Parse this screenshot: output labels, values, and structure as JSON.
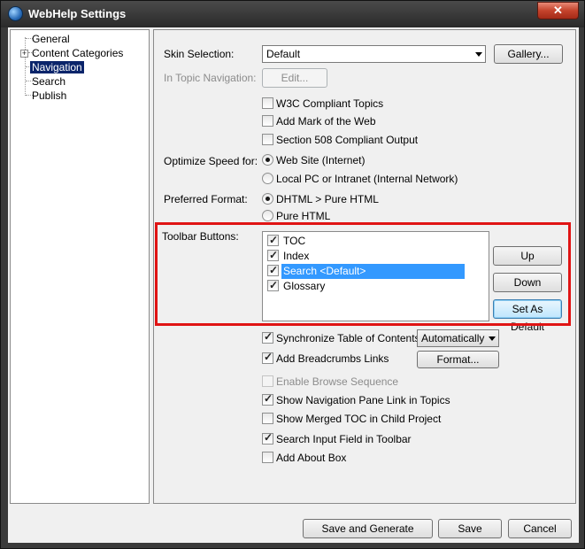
{
  "window": {
    "title": "WebHelp Settings",
    "close_glyph": "✕",
    "icon": "globe-icon"
  },
  "tree": {
    "items": [
      {
        "label": "General"
      },
      {
        "label": "Content Categories",
        "expander": "+"
      },
      {
        "label": "Navigation",
        "selected": true
      },
      {
        "label": "Search"
      },
      {
        "label": "Publish"
      }
    ]
  },
  "skin": {
    "label": "Skin Selection:",
    "value": "Default",
    "gallery_button": "Gallery..."
  },
  "in_topic_nav": {
    "label": "In Topic Navigation:",
    "edit_button": "Edit..."
  },
  "options": {
    "w3c": "W3C Compliant Topics",
    "mark_of_web": "Add Mark of the Web",
    "section508": "Section 508 Compliant Output"
  },
  "optimize": {
    "label": "Optimize Speed for:",
    "web_site": "Web Site (Internet)",
    "local_pc": "Local PC or Intranet (Internal Network)"
  },
  "format": {
    "label": "Preferred Format:",
    "dhtml": "DHTML > Pure HTML",
    "pure_html": "Pure HTML"
  },
  "toolbar": {
    "label": "Toolbar Buttons:",
    "items": [
      {
        "label": "TOC",
        "checked": true
      },
      {
        "label": "Index",
        "checked": true
      },
      {
        "label": "Search <Default>",
        "checked": true,
        "selected": true
      },
      {
        "label": "Glossary",
        "checked": true
      }
    ],
    "up_button": "Up",
    "down_button": "Down",
    "default_button": "Set As Default"
  },
  "sync_toc": {
    "label": "Synchronize Table of Contents",
    "dropdown": "Automatically"
  },
  "breadcrumbs": {
    "label": "Add Breadcrumbs Links",
    "format_button": "Format..."
  },
  "more_options": {
    "browse_sequence": "Enable Browse Sequence",
    "nav_pane_link": "Show Navigation Pane Link in Topics",
    "merged_toc": "Show Merged TOC in Child Project",
    "search_field": "Search Input Field in Toolbar",
    "about_box": "Add About Box"
  },
  "footer": {
    "save_generate": "Save and Generate",
    "save": "Save",
    "cancel": "Cancel"
  },
  "colors": {
    "selection": "#3399ff",
    "tree_selection": "#0a246a",
    "highlight_border": "#e01414",
    "close_button": "#c4432c"
  }
}
